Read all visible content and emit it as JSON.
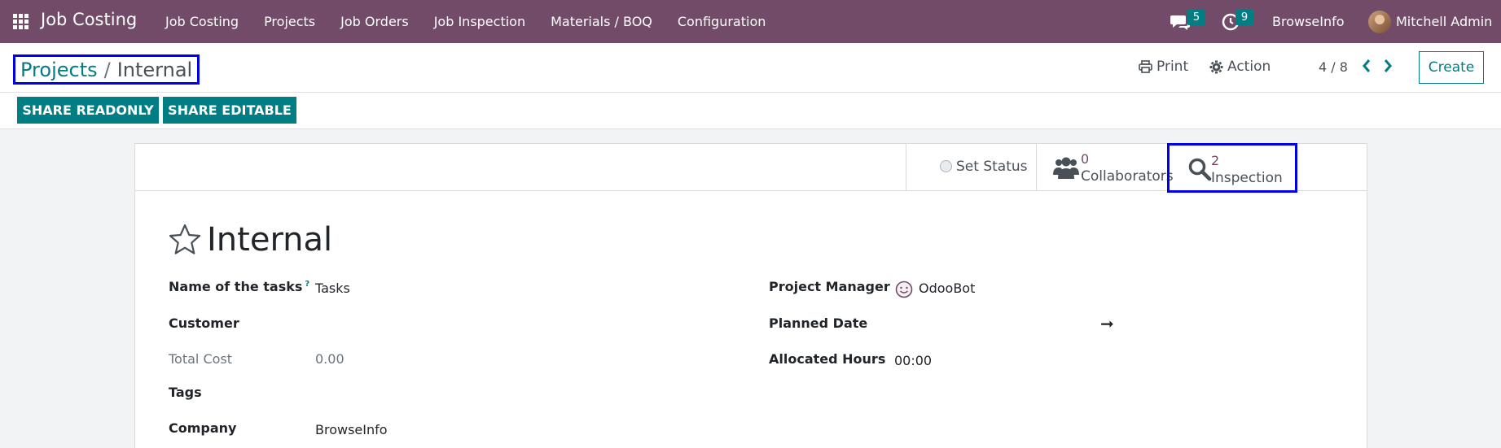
{
  "navbar": {
    "app_name": "Job Costing",
    "menu": [
      "Job Costing",
      "Projects",
      "Job Orders",
      "Job Inspection",
      "Materials / BOQ",
      "Configuration"
    ],
    "messages_count": "5",
    "activities_count": "9",
    "company": "BrowseInfo",
    "user": "Mitchell Admin"
  },
  "breadcrumb": {
    "parent": "Projects",
    "separator": "/",
    "current": "Internal"
  },
  "toolbar": {
    "print_label": "Print",
    "action_label": "Action",
    "pager": "4 / 8",
    "create_label": "Create"
  },
  "share": {
    "readonly_label": "SHARE READONLY",
    "editable_label": "SHARE EDITABLE"
  },
  "button_box": {
    "status_label": "Set Status",
    "collaborators_value": "0",
    "collaborators_label": "Collaborators",
    "inspection_value": "2",
    "inspection_label": "Inspection"
  },
  "record": {
    "title": "Internal"
  },
  "fields_left": [
    {
      "label": "Name of the tasks",
      "help": "?",
      "value": "Tasks"
    },
    {
      "label": "Customer",
      "value": ""
    },
    {
      "label": "Total Cost",
      "value": "0.00"
    },
    {
      "label": "Tags",
      "value": ""
    },
    {
      "label": "Company",
      "value": "BrowseInfo"
    }
  ],
  "fields_right": [
    {
      "label": "Project Manager",
      "value": "OdooBot"
    },
    {
      "label": "Planned Date",
      "value": "",
      "arrow": "➞"
    },
    {
      "label": "Allocated Hours",
      "value": "00:00"
    }
  ],
  "colors": {
    "navbar": "#714b67",
    "accent": "#017e84",
    "highlight": "#0000e6"
  }
}
